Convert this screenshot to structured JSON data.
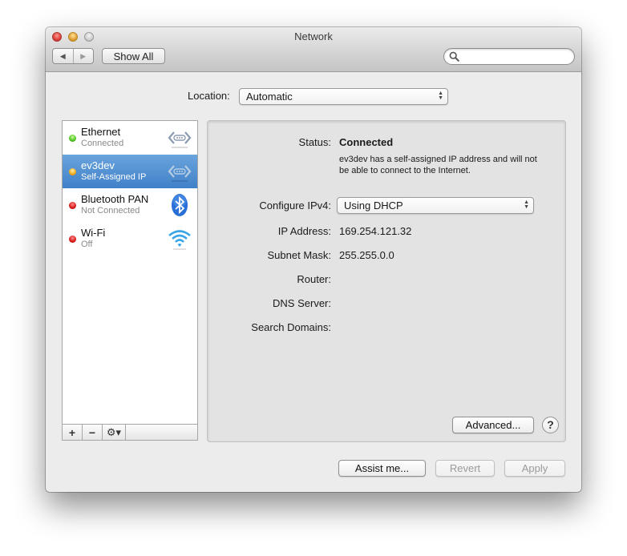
{
  "window": {
    "title": "Network",
    "back_glyph": "◀",
    "forward_glyph": "▶",
    "show_all_label": "Show All",
    "search": {
      "value": "",
      "placeholder": ""
    }
  },
  "location": {
    "label": "Location:",
    "selected": "Automatic"
  },
  "services": [
    {
      "name": "Ethernet",
      "status": "Connected",
      "indicator": "green",
      "icon": "ethernet-icon",
      "selected": false
    },
    {
      "name": "ev3dev",
      "status": "Self-Assigned IP",
      "indicator": "yellow",
      "icon": "ethernet-icon",
      "selected": true
    },
    {
      "name": "Bluetooth PAN",
      "status": "Not Connected",
      "indicator": "red",
      "icon": "bluetooth-icon",
      "selected": false
    },
    {
      "name": "Wi-Fi",
      "status": "Off",
      "indicator": "red",
      "icon": "wifi-icon",
      "selected": false
    }
  ],
  "list_toolbar": {
    "add_glyph": "+",
    "remove_glyph": "−",
    "gear_glyph": "⚙▾"
  },
  "detail": {
    "status_label": "Status:",
    "status_value": "Connected",
    "status_description": "ev3dev has a self-assigned IP address and will not be able to connect to the Internet.",
    "configure_label": "Configure IPv4:",
    "configure_value": "Using DHCP",
    "ip_label": "IP Address:",
    "ip_value": "169.254.121.32",
    "subnet_label": "Subnet Mask:",
    "subnet_value": "255.255.0.0",
    "router_label": "Router:",
    "router_value": "",
    "dns_label": "DNS Server:",
    "dns_value": "",
    "search_domains_label": "Search Domains:",
    "search_domains_value": "",
    "advanced_label": "Advanced...",
    "help_glyph": "?"
  },
  "footer": {
    "assist_label": "Assist me...",
    "revert_label": "Revert",
    "apply_label": "Apply"
  },
  "colors": {
    "selection": "#4a8ad0",
    "connected": "#4bc11e",
    "self_assigned": "#f3a714",
    "disconnected": "#d61414"
  }
}
